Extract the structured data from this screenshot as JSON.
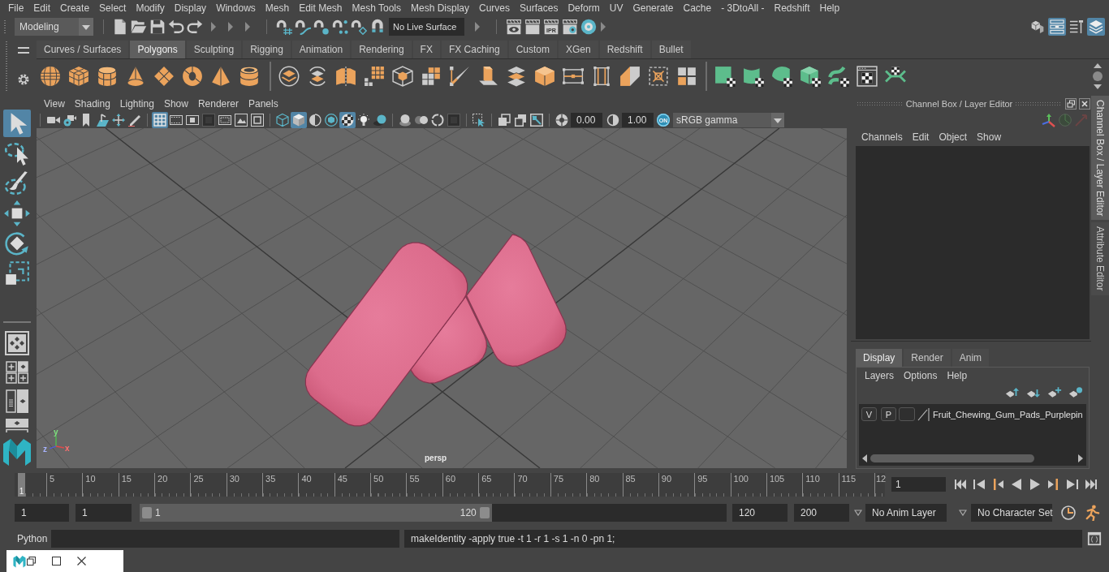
{
  "menu_bar": [
    "File",
    "Edit",
    "Create",
    "Select",
    "Modify",
    "Display",
    "Windows",
    "Mesh",
    "Edit Mesh",
    "Mesh Tools",
    "Mesh Display",
    "Curves",
    "Surfaces",
    "Deform",
    "UV",
    "Generate",
    "Cache",
    "- 3DtoAll -",
    "Redshift",
    "Help"
  ],
  "status_line": {
    "workspace": "Modeling",
    "live_surface": "No Live Surface",
    "ipr_label": "IPR",
    "panel_toggles": [
      {
        "kind": "toolkit",
        "on": false
      },
      {
        "kind": "attributes",
        "on": true
      },
      {
        "kind": "settings",
        "on": false
      },
      {
        "kind": "channels",
        "on": true
      }
    ]
  },
  "shelf": {
    "tabs": [
      {
        "label": "Curves / Surfaces",
        "selected": false
      },
      {
        "label": "Polygons",
        "selected": true
      },
      {
        "label": "Sculpting",
        "selected": false
      },
      {
        "label": "Rigging",
        "selected": false
      },
      {
        "label": "Animation",
        "selected": false
      },
      {
        "label": "Rendering",
        "selected": false
      },
      {
        "label": "FX",
        "selected": false
      },
      {
        "label": "FX Caching",
        "selected": false
      },
      {
        "label": "Custom",
        "selected": false
      },
      {
        "label": "XGen",
        "selected": false
      },
      {
        "label": "Redshift",
        "selected": false
      },
      {
        "label": "Bullet",
        "selected": false
      }
    ]
  },
  "tool_box": [
    {
      "kind": "select",
      "selected": true
    },
    {
      "kind": "lasso",
      "selected": false
    },
    {
      "kind": "paint",
      "selected": false
    },
    {
      "kind": "move",
      "selected": false
    },
    {
      "kind": "rotate",
      "selected": false
    },
    {
      "kind": "scale",
      "selected": false
    }
  ],
  "viewport": {
    "menu": [
      "View",
      "Shading",
      "Lighting",
      "Show",
      "Renderer",
      "Panels"
    ],
    "toolbar": [
      [
        {
          "kind": "camera",
          "on": false
        },
        {
          "kind": "camera_attributes",
          "on": false
        },
        {
          "kind": "bookmark",
          "on": false
        },
        {
          "kind": "image_plane",
          "on": false
        },
        {
          "kind": "pan_zoom",
          "on": false
        },
        {
          "kind": "grease_pencil",
          "on": false
        }
      ],
      [
        {
          "kind": "grid",
          "on": true
        },
        {
          "kind": "film_gate",
          "on": false
        },
        {
          "kind": "resolution_gate",
          "on": false
        },
        {
          "kind": "gate_mask",
          "on": false
        },
        {
          "kind": "field_chart",
          "on": false
        },
        {
          "kind": "safe_action",
          "on": false
        },
        {
          "kind": "safe_title",
          "on": false
        }
      ],
      [
        {
          "kind": "wireframe",
          "on": false
        },
        {
          "kind": "smooth_shade",
          "on": true
        },
        {
          "kind": "wire_on_shaded",
          "on": false
        },
        {
          "kind": "textured",
          "on": false
        },
        {
          "kind": "checker",
          "on": true
        },
        {
          "kind": "lights",
          "on": false
        },
        {
          "kind": "shadows",
          "on": false
        }
      ],
      [
        {
          "kind": "ambient_occlusion",
          "on": false
        },
        {
          "kind": "motion_blur",
          "on": false
        },
        {
          "kind": "anti_alias",
          "on": false
        },
        {
          "kind": "depth_of_field",
          "on": false
        }
      ],
      [
        {
          "kind": "isolate",
          "on": false
        }
      ],
      [
        {
          "kind": "xray",
          "on": false
        },
        {
          "kind": "xray_joints",
          "on": false
        },
        {
          "kind": "xray_components",
          "on": false
        }
      ]
    ],
    "exposure": "0.00",
    "gamma": "1.00",
    "color_management": {
      "label": "ON",
      "on": true
    },
    "view_transform": "sRGB gamma",
    "camera": "persp",
    "axes": [
      "x",
      "y",
      "z"
    ]
  },
  "channel_box": {
    "title": "Channel Box / Layer Editor",
    "menu": [
      "Channels",
      "Edit",
      "Object",
      "Show"
    ],
    "layer_tabs": [
      {
        "label": "Display",
        "selected": true
      },
      {
        "label": "Render",
        "selected": false
      },
      {
        "label": "Anim",
        "selected": false
      }
    ],
    "layer_menu": [
      "Layers",
      "Options",
      "Help"
    ],
    "layers": [
      {
        "visibility": "V",
        "playback": "P",
        "name": "Fruit_Chewing_Gum_Pads_Purplepin"
      }
    ]
  },
  "side_tabs": [
    {
      "label": "Channel Box / Layer Editor",
      "selected": true
    },
    {
      "label": "Attribute Editor",
      "selected": false
    }
  ],
  "time_slider": {
    "current_frame": "1",
    "level": 0,
    "frame_labels": [
      "5",
      "10",
      "15",
      "20",
      "25",
      "30",
      "35",
      "40",
      "45",
      "50",
      "55",
      "60",
      "65",
      "70",
      "75",
      "80",
      "85",
      "90",
      "95",
      "100",
      "105",
      "110",
      "115",
      "12"
    ],
    "current_field": "1"
  },
  "range_slider": {
    "anim_start": "1",
    "play_start": "1",
    "range_start": "1",
    "range_end": "120",
    "level": 0.6,
    "play_end": "120",
    "anim_end": "200",
    "anim_layer": "No Anim Layer",
    "character_set": "No Character Set"
  },
  "command_line": {
    "language": "Python",
    "result": "makeIdentity -apply true -t 1 -r 1 -s 1 -n 0 -pn 1;"
  }
}
